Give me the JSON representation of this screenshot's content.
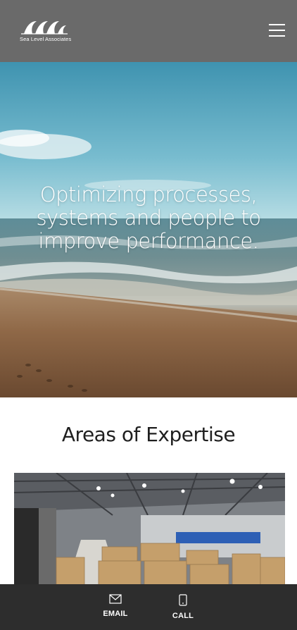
{
  "header": {
    "logo_text": "Sea Level Associates",
    "menu_icon": "hamburger-menu-icon"
  },
  "hero": {
    "title": "Optimizing processes, systems and people to improve performance."
  },
  "expertise": {
    "title": "Areas of Expertise"
  },
  "bottom_bar": {
    "email": {
      "label": "EMAIL",
      "icon": "envelope-icon"
    },
    "call": {
      "label": "CALL",
      "icon": "phone-icon"
    }
  },
  "colors": {
    "header_bg": "#6a6a6a",
    "bottom_bar_bg": "#2d2d2d",
    "text_dark": "#1f1f1f"
  }
}
